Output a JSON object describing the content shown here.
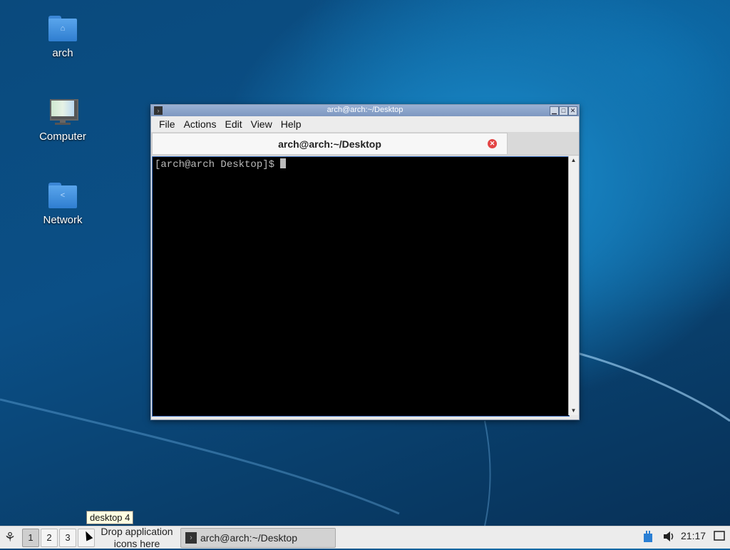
{
  "desktop": {
    "icons": [
      {
        "label": "arch",
        "icon": "home-folder-icon"
      },
      {
        "label": "Computer",
        "icon": "computer-icon"
      },
      {
        "label": "Network",
        "icon": "network-folder-icon"
      }
    ]
  },
  "window": {
    "title": "arch@arch:~/Desktop",
    "buttons": {
      "minimize": "▁",
      "maximize": "□",
      "close": "✕"
    },
    "menu": [
      "File",
      "Actions",
      "Edit",
      "View",
      "Help"
    ],
    "tab": {
      "title": "arch@arch:~/Desktop",
      "close_glyph": "✕"
    },
    "terminal": {
      "prompt": "[arch@arch Desktop]$ "
    },
    "scroll": {
      "up": "▲",
      "down": "▼"
    }
  },
  "taskbar": {
    "workspaces": [
      "1",
      "2",
      "3"
    ],
    "active_workspace": "1",
    "launch_hint": "Drop application icons here",
    "task": {
      "label": "arch@arch:~/Desktop"
    },
    "clock": "21:17",
    "tooltip": "desktop 4"
  },
  "colors": {
    "desktop_bg": "#0b4f86",
    "terminal_bg": "#000000",
    "tab_close": "#e34545"
  }
}
